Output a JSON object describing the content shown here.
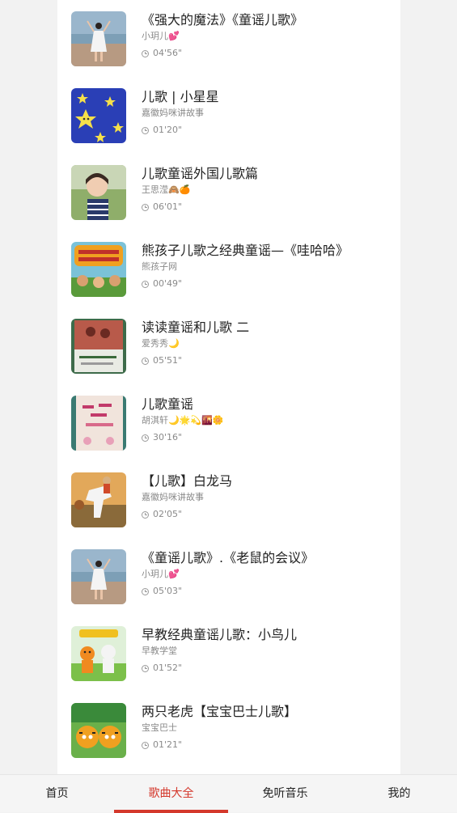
{
  "songs": [
    {
      "title": "《强大的魔法》《童谣儿歌》",
      "author": "小玥儿💕",
      "duration": "04'56\"",
      "thumb": "girl-beach"
    },
    {
      "title": "儿歌 | 小星星",
      "author": "嘉徽妈咪讲故事",
      "duration": "01'20\"",
      "thumb": "stars"
    },
    {
      "title": "儿歌童谣外国儿歌篇",
      "author": "王思滢🙈🍊",
      "duration": "06'01\"",
      "thumb": "girl-portrait"
    },
    {
      "title": "熊孩子儿歌之经典童谣—《哇哈哈》",
      "author": "熊孩子网",
      "duration": "00'49\"",
      "thumb": "cartoon-kids"
    },
    {
      "title": "读读童谣和儿歌 二",
      "author": "爱秀秀🌙",
      "duration": "05'51\"",
      "thumb": "book-cover"
    },
    {
      "title": "儿歌童谣",
      "author": "胡淇轩🌙🌟💫🌇🌼",
      "duration": "30'16\"",
      "thumb": "book-pink"
    },
    {
      "title": "【儿歌】白龙马",
      "author": "嘉徽妈咪讲故事",
      "duration": "02'05\"",
      "thumb": "white-horse"
    },
    {
      "title": "《童谣儿歌》.《老鼠的会议》",
      "author": "小玥儿💕",
      "duration": "05'03\"",
      "thumb": "girl-beach"
    },
    {
      "title": "早教经典童谣儿歌：小鸟儿",
      "author": "早教学堂",
      "duration": "01'52\"",
      "thumb": "tiger-rabbit"
    },
    {
      "title": "两只老虎【宝宝巴士儿歌】",
      "author": "宝宝巴士",
      "duration": "01'21\"",
      "thumb": "two-tigers"
    }
  ],
  "tabs": [
    {
      "label": "首页",
      "active": false
    },
    {
      "label": "歌曲大全",
      "active": true
    },
    {
      "label": "免听音乐",
      "active": false
    },
    {
      "label": "我的",
      "active": false
    }
  ],
  "colors": {
    "accent": "#d4382c",
    "text": "#222222",
    "muted": "#8a8a8a"
  }
}
